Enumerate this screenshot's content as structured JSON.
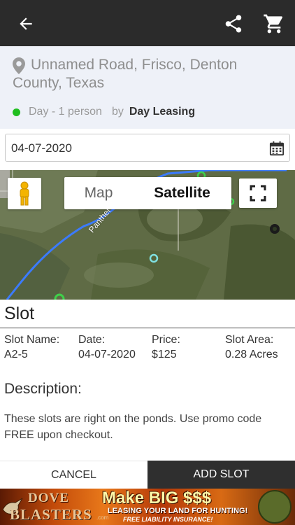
{
  "header": {
    "back_icon": "arrow-back-icon",
    "share_icon": "share-icon",
    "cart_icon": "shopping-cart-icon"
  },
  "listing": {
    "address": "Unnamed Road, Frisco, Denton County, Texas",
    "availability": "Day - 1 person",
    "by_label": "by",
    "host": "Day Leasing",
    "status_color": "#1fbe1f"
  },
  "date_input": {
    "value": "04-07-2020"
  },
  "map": {
    "map_label": "Map",
    "satellite_label": "Satellite",
    "selected_type": "Satellite",
    "road_label": "Panther Cr"
  },
  "slot": {
    "title": "Slot",
    "columns": [
      {
        "label": "Slot Name:",
        "value": "A2-5"
      },
      {
        "label": "Date:",
        "value": "04-07-2020"
      },
      {
        "label": "Price:",
        "value": "$125"
      },
      {
        "label": "Slot Area:",
        "value": "0.28 Acres"
      }
    ],
    "description_title": "Description:",
    "description": "These slots are right on the ponds. Use promo code FREE upon checkout."
  },
  "actions": {
    "cancel": "CANCEL",
    "add": "ADD SLOT"
  },
  "banner": {
    "line1": "DOVE",
    "line2": "BLASTERS",
    "domain_suffix": ".com",
    "headline": "Make BIG $$$",
    "subline": "LEASING YOUR LAND FOR HUNTING!",
    "tagline": "FREE LIABILITY INSURANCE!"
  },
  "colors": {
    "topbar": "#2b2b2b",
    "info_bg": "#eef1f8",
    "add_button": "#2f2f2f"
  }
}
